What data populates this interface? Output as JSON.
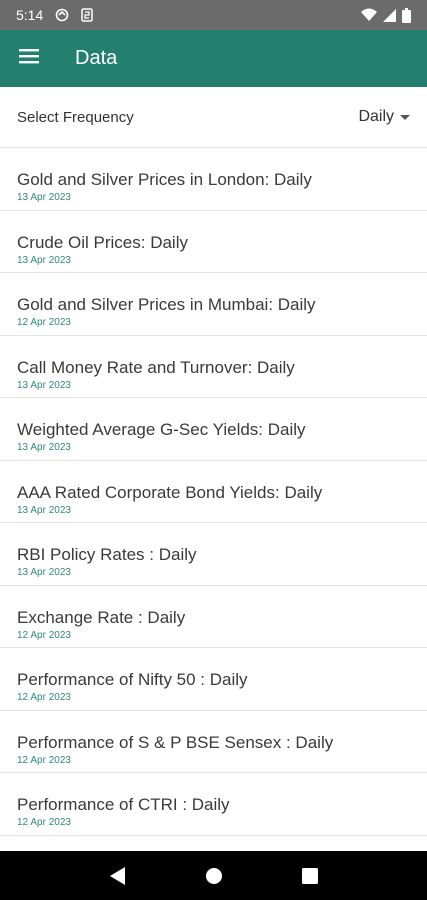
{
  "status_bar": {
    "time": "5:14"
  },
  "app_bar": {
    "title": "Data"
  },
  "frequency": {
    "label": "Select Frequency",
    "selected": "Daily"
  },
  "items": [
    {
      "title": "Gold and Silver Prices in London: Daily",
      "date": "13 Apr 2023"
    },
    {
      "title": "Crude Oil Prices: Daily",
      "date": "13 Apr 2023"
    },
    {
      "title": "Gold and Silver Prices in Mumbai: Daily",
      "date": "12 Apr 2023"
    },
    {
      "title": "Call Money Rate and Turnover: Daily",
      "date": "13 Apr 2023"
    },
    {
      "title": "Weighted Average G-Sec Yields: Daily",
      "date": "13 Apr 2023"
    },
    {
      "title": "AAA Rated Corporate Bond Yields: Daily",
      "date": "13 Apr 2023"
    },
    {
      "title": "RBI Policy Rates : Daily",
      "date": "13 Apr 2023"
    },
    {
      "title": "Exchange Rate : Daily",
      "date": "12 Apr 2023"
    },
    {
      "title": "Performance of Nifty 50 : Daily",
      "date": "12 Apr 2023"
    },
    {
      "title": "Performance of S & P BSE Sensex : Daily",
      "date": "12 Apr 2023"
    },
    {
      "title": "Performance of CTRI : Daily",
      "date": "12 Apr 2023"
    }
  ],
  "colors": {
    "app_bar": "#24806e",
    "date_text": "#2f8a78",
    "status_bar": "#6b6b6b"
  },
  "icons": [
    "signal-icon",
    "sync-icon",
    "sim-icon",
    "wifi-icon",
    "cellular-icon",
    "battery-icon",
    "menu-icon",
    "dropdown-arrow-icon",
    "back-icon",
    "home-icon",
    "recents-icon"
  ]
}
